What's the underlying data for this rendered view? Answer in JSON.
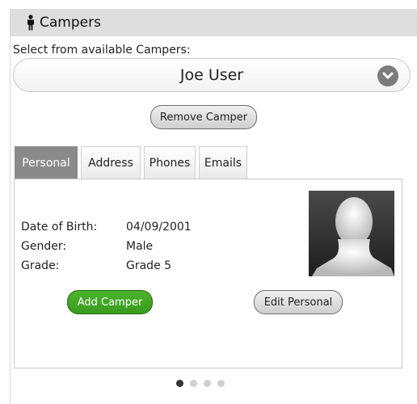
{
  "header": {
    "title": "Campers",
    "icon": "person-icon"
  },
  "select": {
    "label": "Select from available Campers:",
    "value": "Joe User",
    "icon": "chevron-down-icon"
  },
  "buttons": {
    "remove": "Remove Camper",
    "add": "Add Camper",
    "edit": "Edit Personal"
  },
  "tabs": [
    {
      "label": "Personal",
      "active": true
    },
    {
      "label": "Address",
      "active": false
    },
    {
      "label": "Phones",
      "active": false
    },
    {
      "label": "Emails",
      "active": false
    }
  ],
  "personal": {
    "dob_label": "Date of Birth:",
    "dob_value": "04/09/2001",
    "gender_label": "Gender:",
    "gender_value": "Male",
    "grade_label": "Grade:",
    "grade_value": "Grade 5"
  },
  "pager": {
    "active_index": 0,
    "count": 4
  },
  "colors": {
    "header_bg": "#dedede",
    "active_tab": "#8a8a8a",
    "add_button": "#3fa524"
  }
}
